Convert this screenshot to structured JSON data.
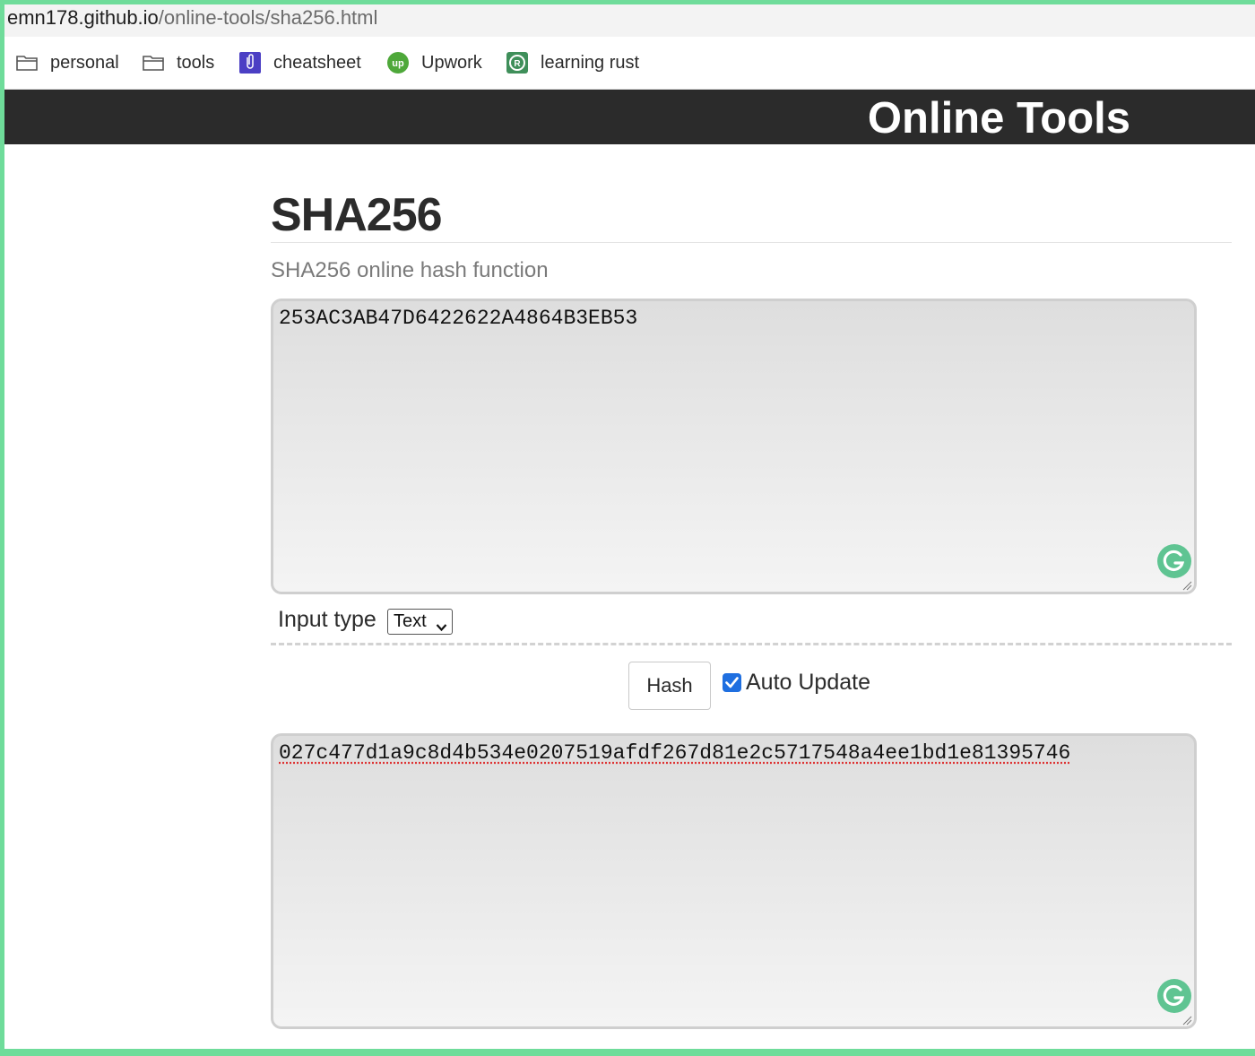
{
  "browser": {
    "url_host": "emn178.github.io",
    "url_path": "/online-tools/sha256.html"
  },
  "bookmarks": [
    {
      "label": "personal",
      "icon": "folder-icon"
    },
    {
      "label": "tools",
      "icon": "folder-icon"
    },
    {
      "label": "cheatsheet",
      "icon": "clip-icon"
    },
    {
      "label": "Upwork",
      "icon": "upwork-icon"
    },
    {
      "label": "learning rust",
      "icon": "rust-icon"
    }
  ],
  "header": {
    "brand": "Online Tools"
  },
  "page": {
    "title": "SHA256",
    "subtitle": "SHA256 online hash function"
  },
  "input": {
    "value": "253AC3AB47D6422622A4864B3EB53"
  },
  "options": {
    "input_type_label": "Input type",
    "input_type_selected": "Text",
    "hash_button": "Hash",
    "auto_update_label": "Auto Update",
    "auto_update_checked": true
  },
  "output": {
    "value": "027c477d1a9c8d4b534e0207519afdf267d81e2c5717548a4ee1bd1e81395746"
  },
  "colors": {
    "header_bg": "#2b2b2b",
    "accent_green": "#6fdc9a",
    "grammarly_green": "#5fc492",
    "checkbox_blue": "#1f6fe0"
  }
}
